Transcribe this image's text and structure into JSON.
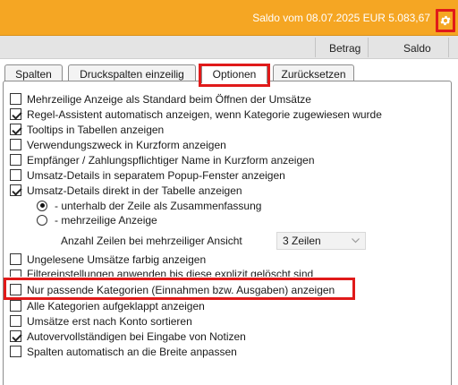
{
  "saldo": {
    "text": "Saldo vom 08.07.2025 EUR 5.083,67",
    "color_bg": "#f5a623"
  },
  "columns": {
    "betrag": "Betrag",
    "saldo": "Saldo"
  },
  "tabs": [
    {
      "label": "Spalten",
      "active": false
    },
    {
      "label": "Druckspalten einzeilig",
      "active": false
    },
    {
      "label": "Optionen",
      "active": true
    },
    {
      "label": "Zurücksetzen",
      "active": false
    }
  ],
  "options": [
    {
      "label": "Mehrzeilige Anzeige als Standard beim Öffnen der Umsätze",
      "checked": false
    },
    {
      "label": "Regel-Assistent automatisch anzeigen, wenn Kategorie zugewiesen wurde",
      "checked": true
    },
    {
      "label": "Tooltips in Tabellen anzeigen",
      "checked": true
    },
    {
      "label": "Verwendungszweck in Kurzform anzeigen",
      "checked": false
    },
    {
      "label": "Empfänger / Zahlungspflichtiger Name in Kurzform anzeigen",
      "checked": false
    },
    {
      "label": "Umsatz-Details in separatem Popup-Fenster anzeigen",
      "checked": false
    },
    {
      "label": "Umsatz-Details direkt in der Tabelle anzeigen",
      "checked": true
    }
  ],
  "radios": [
    {
      "label": "- unterhalb der Zeile als Zusammenfassung",
      "selected": true
    },
    {
      "label": "- mehrzeilige Anzeige",
      "selected": false
    }
  ],
  "rows_setting": {
    "label": "Anzahl Zeilen bei mehrzeiliger Ansicht",
    "value": "3 Zeilen"
  },
  "options_lower": [
    {
      "label": "Ungelesene Umsätze farbig anzeigen",
      "checked": false
    },
    {
      "label": "Filtereinstellungen anwenden bis diese explizit gelöscht sind",
      "checked": false
    },
    {
      "label": "Nur passende Kategorien (Einnahmen bzw. Ausgaben) anzeigen",
      "checked": false
    },
    {
      "label": "Alle Kategorien aufgeklappt anzeigen",
      "checked": false
    },
    {
      "label": "Umsätze erst nach Konto sortieren",
      "checked": false
    },
    {
      "label": "Autovervollständigen bei Eingabe von Notizen",
      "checked": true
    },
    {
      "label": "Spalten automatisch an die Breite anpassen",
      "checked": false
    }
  ],
  "icons": {
    "settings": "gear-icon",
    "select_arrow": "chevron-down-icon"
  },
  "highlight_color": "#e01a1a"
}
